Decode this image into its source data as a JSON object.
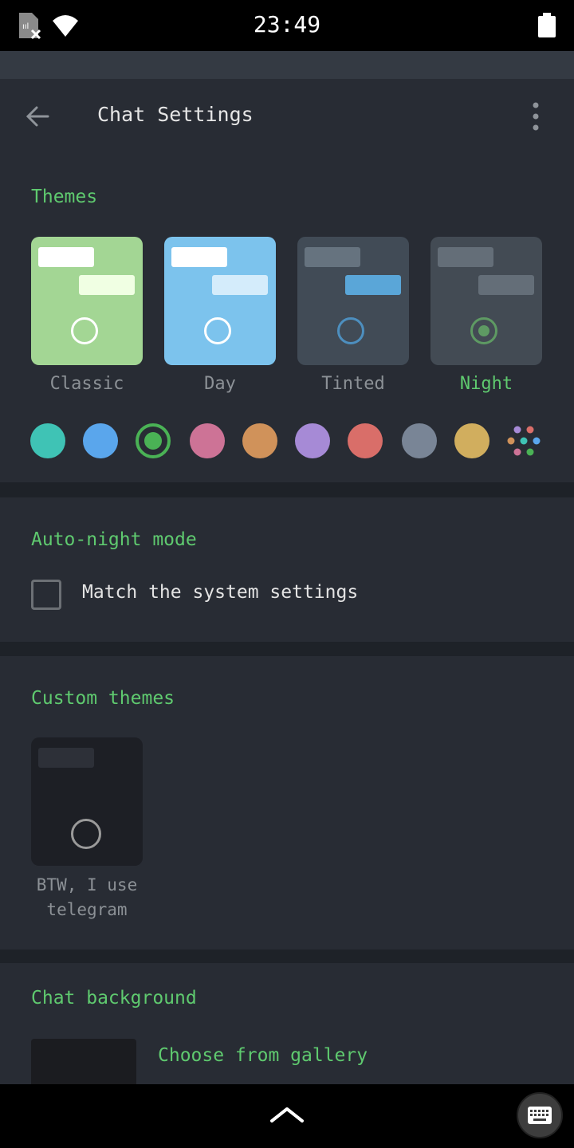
{
  "status_bar": {
    "time": "23:49"
  },
  "app_bar": {
    "title": "Chat Settings",
    "back_icon": "arrow-left-icon",
    "menu_icon": "more-vert-icon"
  },
  "themes": {
    "title": "Themes",
    "selected": "Night",
    "items": [
      {
        "name": "Classic",
        "bg": "#a3d694",
        "bubble_in": "#ffffff",
        "bubble_out": "#f0ffe3",
        "ring": "#ffffff",
        "label_color": "#8c9196",
        "selected": false
      },
      {
        "name": "Day",
        "bg": "#7cc3ed",
        "bubble_in": "#ffffff",
        "bubble_out": "#d4ecfb",
        "ring": "#ffffff",
        "label_color": "#8c9196",
        "selected": false
      },
      {
        "name": "Tinted",
        "bg": "#414b56",
        "bubble_in": "#66737f",
        "bubble_out": "#5aa6d8",
        "ring": "#4d8fbf",
        "label_color": "#8c9196",
        "selected": false
      },
      {
        "name": "Night",
        "bg": "#434b54",
        "bubble_in": "#646e78",
        "bubble_out": "#646e78",
        "ring": "#5e9a63",
        "label_color": "#5fca6f",
        "selected": true
      }
    ]
  },
  "accent_colors": {
    "selected": "#4ab255",
    "swatches": [
      "#3fc3b5",
      "#5aa6ec",
      "#4ab255",
      "#cd7396",
      "#d0925a",
      "#a68ad6",
      "#d96e69",
      "#798596",
      "#d1ae5e"
    ],
    "more_icon": "palette-dots-icon"
  },
  "auto_night": {
    "title": "Auto-night mode",
    "checkbox_label": "Match the system settings",
    "checked": false
  },
  "custom_themes": {
    "title": "Custom themes",
    "items": [
      {
        "name": "BTW, I use telegram"
      }
    ]
  },
  "chat_background": {
    "title": "Chat background",
    "choose_label": "Choose from gallery"
  },
  "nav_bar": {
    "up_icon": "chevron-up-icon",
    "keyboard_icon": "keyboard-icon"
  }
}
